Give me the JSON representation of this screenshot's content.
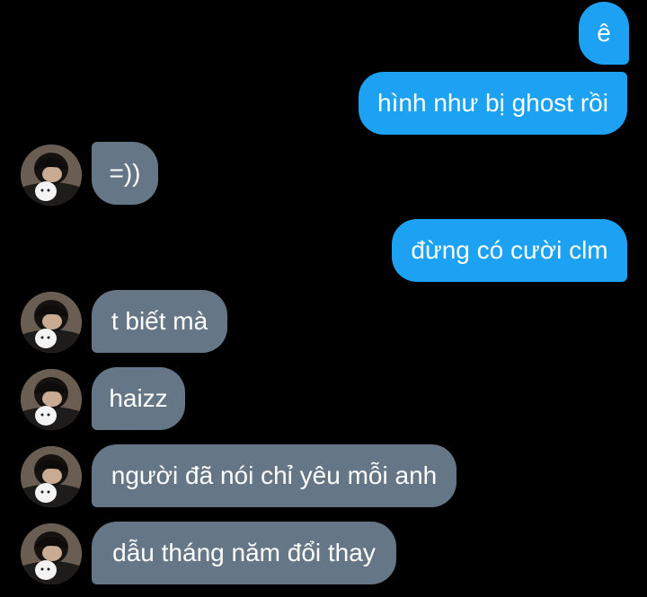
{
  "conversation": {
    "messages": [
      {
        "sender": "me",
        "text": "ê"
      },
      {
        "sender": "me",
        "text": "hình như bị ghost rồi"
      },
      {
        "sender": "them",
        "text": "=))"
      },
      {
        "sender": "me",
        "text": "đừng có cười clm"
      },
      {
        "sender": "them",
        "text": "t biết mà"
      },
      {
        "sender": "them",
        "text": "haizz"
      },
      {
        "sender": "them",
        "text": "người đã nói chỉ yêu mỗi anh"
      },
      {
        "sender": "them",
        "text": "dẫu tháng năm đổi thay"
      }
    ]
  },
  "colors": {
    "background": "#000000",
    "sent_bubble": "#1da1f2",
    "received_bubble": "#657786",
    "text": "#ffffff"
  },
  "icons": {
    "avatar": "contact-avatar-photo"
  }
}
